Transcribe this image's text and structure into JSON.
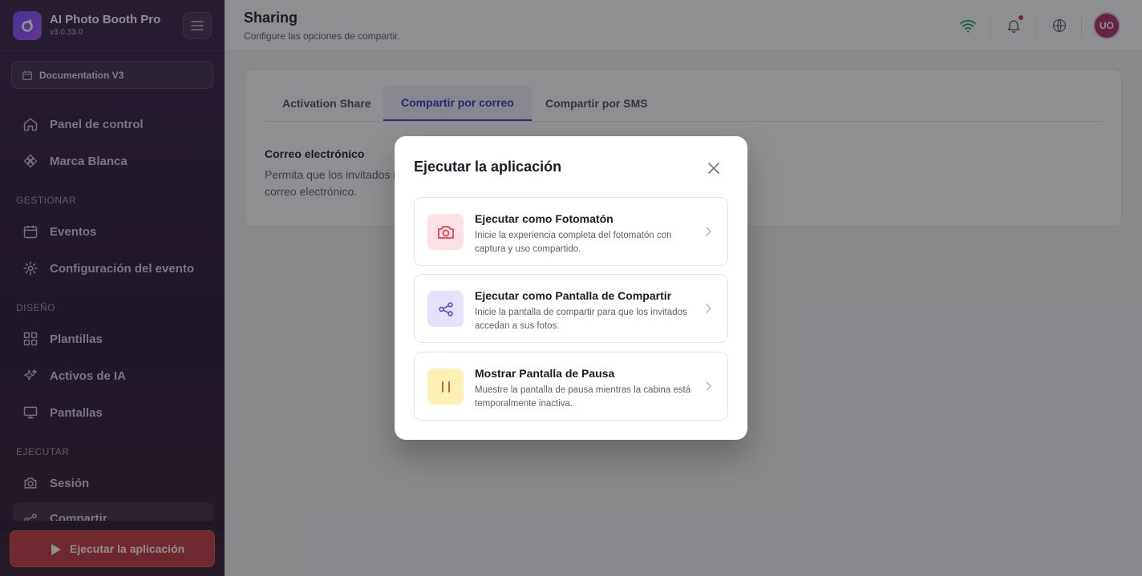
{
  "app": {
    "title": "AI Photo Booth Pro",
    "version": "v3.0.33.0"
  },
  "sidebar": {
    "workspace": "Documentation V3",
    "items_top": [
      {
        "label": "Panel de control",
        "icon": "home-icon"
      },
      {
        "label": "Marca Blanca",
        "icon": "diamond-icon"
      }
    ],
    "section_manage": "GESTIONAR",
    "items_manage": [
      {
        "label": "Eventos",
        "icon": "calendar-icon"
      },
      {
        "label": "Configuración del evento",
        "icon": "gear-icon"
      }
    ],
    "section_design": "DISEÑO",
    "items_design": [
      {
        "label": "Plantillas",
        "icon": "grid-icon"
      },
      {
        "label": "Activos de IA",
        "icon": "sparkles-icon"
      },
      {
        "label": "Pantallas",
        "icon": "monitor-icon"
      }
    ],
    "section_run": "EJECUTAR",
    "items_run": [
      {
        "label": "Sesión",
        "icon": "camera-icon"
      },
      {
        "label": "Compartir",
        "icon": "share-icon"
      }
    ],
    "run_button": "Ejecutar la aplicación"
  },
  "header": {
    "title": "Sharing",
    "subtitle": "Configure las opciones de compartir.",
    "avatar_initials": "UO"
  },
  "content": {
    "tabs": [
      "Activation Share",
      "Compartir por correo",
      "Compartir por SMS"
    ],
    "active_tab": "Compartir por correo",
    "section_title": "Correo electrónico",
    "section_desc_line1": "Permita que los invitados r",
    "section_desc_line2": "correo electrónico."
  },
  "modal": {
    "title": "Ejecutar la aplicación",
    "options": [
      {
        "title": "Ejecutar como Fotomatón",
        "desc": "Inicie la experiencia completa del fotomatón con captura y uso compartido.",
        "icon": "camera-icon",
        "color": "#e0455c"
      },
      {
        "title": "Ejecutar como Pantalla de Compartir",
        "desc": "Inicie la pantalla de compartir para que los invitados accedan a sus fotos.",
        "icon": "share-icon",
        "color": "#5b4fcf"
      },
      {
        "title": "Mostrar Pantalla de Pausa",
        "desc": "Muestre la pantalla de pausa mientras la cabina está temporalmente inactiva.",
        "icon": "pause-icon",
        "color": "#c9a013"
      }
    ]
  },
  "colors": {
    "accent": "#4a45d6",
    "run_button": "#c23b45",
    "wifi": "#22a05a",
    "avatar": "#b0306b"
  }
}
